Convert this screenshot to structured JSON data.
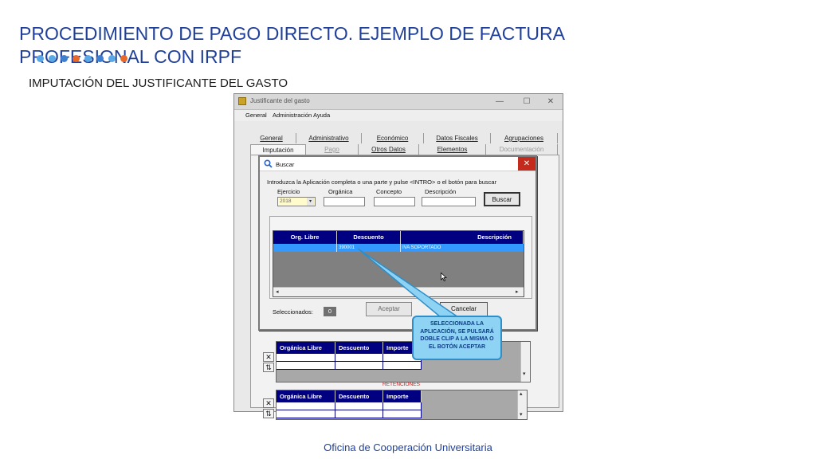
{
  "slide": {
    "title": "PROCEDIMIENTO DE PAGO DIRECTO. EJEMPLO DE FACTURA PROFESIONAL CON IRPF",
    "subtitle": "IMPUTACIÓN DEL JUSTIFICANTE DEL GASTO",
    "footer": "Oficina de Cooperación Universitaria",
    "dot_colors": [
      "#5aa9e6",
      "#5aa9e6",
      "#3f7fd0",
      "#e8692a",
      "#5aa9e6",
      "#3f7fd0",
      "#5aa9e6",
      "#e8692a"
    ]
  },
  "main_window": {
    "title": "Justificante del gasto",
    "controls": [
      "—",
      "☐",
      "✕"
    ],
    "menu": [
      "General",
      "Administración",
      "Ayuda"
    ],
    "tabs_row1": [
      {
        "label": "General",
        "state": "normal"
      },
      {
        "label": "Administrativo",
        "state": "normal"
      },
      {
        "label": "Económico",
        "state": "normal"
      },
      {
        "label": "Datos Fiscales",
        "state": "normal"
      },
      {
        "label": "Agrupaciones",
        "state": "normal"
      }
    ],
    "tabs_row2": [
      {
        "label": "Imputación",
        "state": "active"
      },
      {
        "label": "Pago",
        "state": "disabled"
      },
      {
        "label": "Otros Datos",
        "state": "normal"
      },
      {
        "label": "Elementos",
        "state": "normal"
      },
      {
        "label": "Documentación",
        "state": "disabled"
      }
    ],
    "upper_grid_columns": [
      "Orgánica Libre",
      "Descuento",
      "Importe"
    ],
    "retenciones_label": "RETENCIONES",
    "lower_grid_columns": [
      "Orgánica Libre",
      "Descuento",
      "Importe"
    ],
    "side_buttons": [
      "✕",
      "⇅"
    ]
  },
  "search_dialog": {
    "title": "Buscar",
    "close_glyph": "✕",
    "instruction": "Introduzca la Aplicación completa o una parte y pulse <INTRO> o el botón para buscar",
    "fields": {
      "ejercicio_label": "Ejercicio",
      "ejercicio_value": "2018",
      "organica_label": "Orgánica",
      "concepto_label": "Concepto",
      "descripcion_label": "Descripción"
    },
    "buscar_label": "Buscar",
    "columns": [
      "Org. Libre",
      "Descuento",
      "Descripción"
    ],
    "rows": [
      {
        "org_libre": "",
        "descuento": "390001",
        "descripcion": "IVA SOPORTADO"
      }
    ],
    "selected_label": "Seleccionados:",
    "selected_count": "0",
    "accept_label": "Aceptar",
    "cancel_label": "Cancelar"
  },
  "callout": {
    "text": "SELECCIONADA LA APLICACIÓN, SE PULSARÁ DOBLE CLIP A LA MISMA O EL BOTÓN ACEPTAR",
    "fill": "#8ed2f4",
    "border": "#2e8ec8"
  }
}
